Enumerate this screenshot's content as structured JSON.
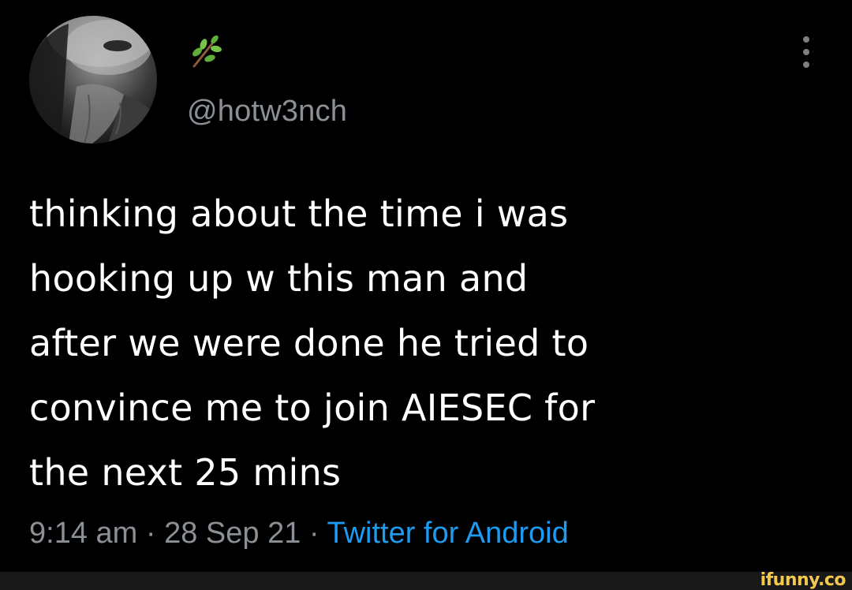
{
  "user": {
    "avatar_alt": "profile picture",
    "display_name_icon": "herb-emoji",
    "handle": "@hotw3nch"
  },
  "menu": {
    "icon": "more-vertical-icon"
  },
  "tweet": {
    "text": "thinking about the time i was\nhooking up w this man and\nafter we were done he tried to\nconvince me to join AIESEC for\nthe next 25 mins"
  },
  "meta": {
    "time": "9:14 am",
    "separator1": " · ",
    "date": "28 Sep 21",
    "separator2": " · ",
    "source": "Twitter for Android"
  },
  "watermark": {
    "text": "ifunny.co"
  },
  "colors": {
    "background": "#000000",
    "text": "#ffffff",
    "secondary": "#8b9096",
    "link": "#1d9bf0",
    "watermark": "#f2c94c"
  }
}
